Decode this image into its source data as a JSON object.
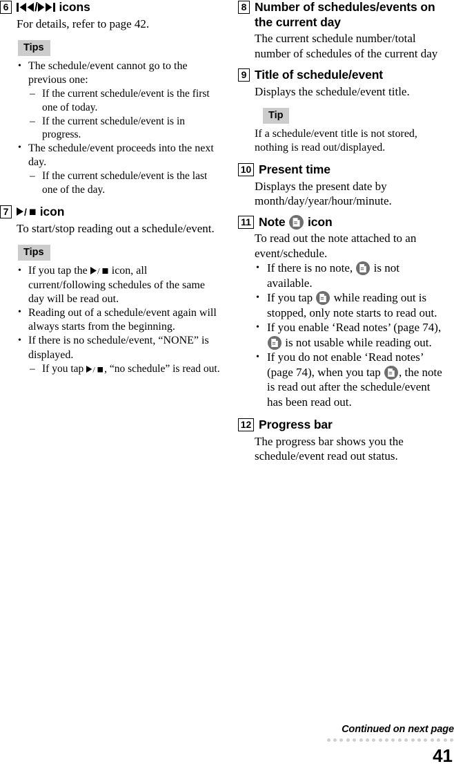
{
  "page": {
    "number": "41",
    "continued_note": "Continued on next page"
  },
  "left_column": {
    "sections": [
      {
        "number": "6",
        "title_prefix": "",
        "title_icons": [
          "prev-track-icon",
          "next-track-icon"
        ],
        "title_text": "icons",
        "body": "For details, refer to page 42.",
        "tips_label": "Tips",
        "tips": [
          {
            "text": "The schedule/event cannot go to the previous one:",
            "sub": [
              "If the current schedule/event is the first one of today.",
              "If the current schedule/event is in progress."
            ]
          },
          {
            "text": "The schedule/event proceeds into the next day.",
            "sub": [
              "If the current schedule/event is the last one of the day."
            ]
          }
        ]
      },
      {
        "number": "7",
        "title_icons": [
          "play-stop-icon"
        ],
        "title_text": "icon",
        "body": "To start/stop reading out a schedule/event.",
        "tips_label": "Tips",
        "tips": [
          {
            "text_before": "If you tap the",
            "text_after": "icon, all current/following schedules of the same day will be read out.",
            "has_icon": true,
            "sub": []
          },
          {
            "text": "Reading out of a schedule/event again will always starts from the beginning.",
            "sub": []
          },
          {
            "text": "If there is no schedule/event, “NONE” is displayed.",
            "sub_icon_item": {
              "before": "If you tap",
              "after": ", “no schedule” is read out."
            }
          }
        ]
      }
    ]
  },
  "right_column": {
    "sections": [
      {
        "number": "8",
        "title_text": "Number of schedules/events on the current day",
        "body": "The current schedule number/total number of schedules of the current day"
      },
      {
        "number": "9",
        "title_text": "Title of schedule/event",
        "body": "Displays the schedule/event title.",
        "tip_label": "Tip",
        "tip_body": "If a schedule/event title is not stored, nothing is read out/displayed."
      },
      {
        "number": "10",
        "title_text": "Present time",
        "body": "Displays the present date by month/day/year/hour/minute."
      },
      {
        "number": "11",
        "title_prefix": "Note",
        "title_icon": "note-icon",
        "title_suffix": "icon",
        "body": "To read out the note attached to an event/schedule.",
        "bullets": [
          {
            "before": "If there is no note,",
            "after": "is not available."
          },
          {
            "before": "If you tap",
            "after": "while reading out is stopped, only note starts to read out."
          },
          {
            "before": "If you enable ‘Read notes’ (page 74),",
            "after": "is not usable while reading out."
          },
          {
            "before": "If you do not enable ‘Read notes’ (page 74), when you tap",
            "after": ", the note is read out after the schedule/event has been read out."
          }
        ]
      },
      {
        "number": "12",
        "title_text": "Progress bar",
        "body": "The progress bar shows you the schedule/event read out status."
      }
    ]
  }
}
